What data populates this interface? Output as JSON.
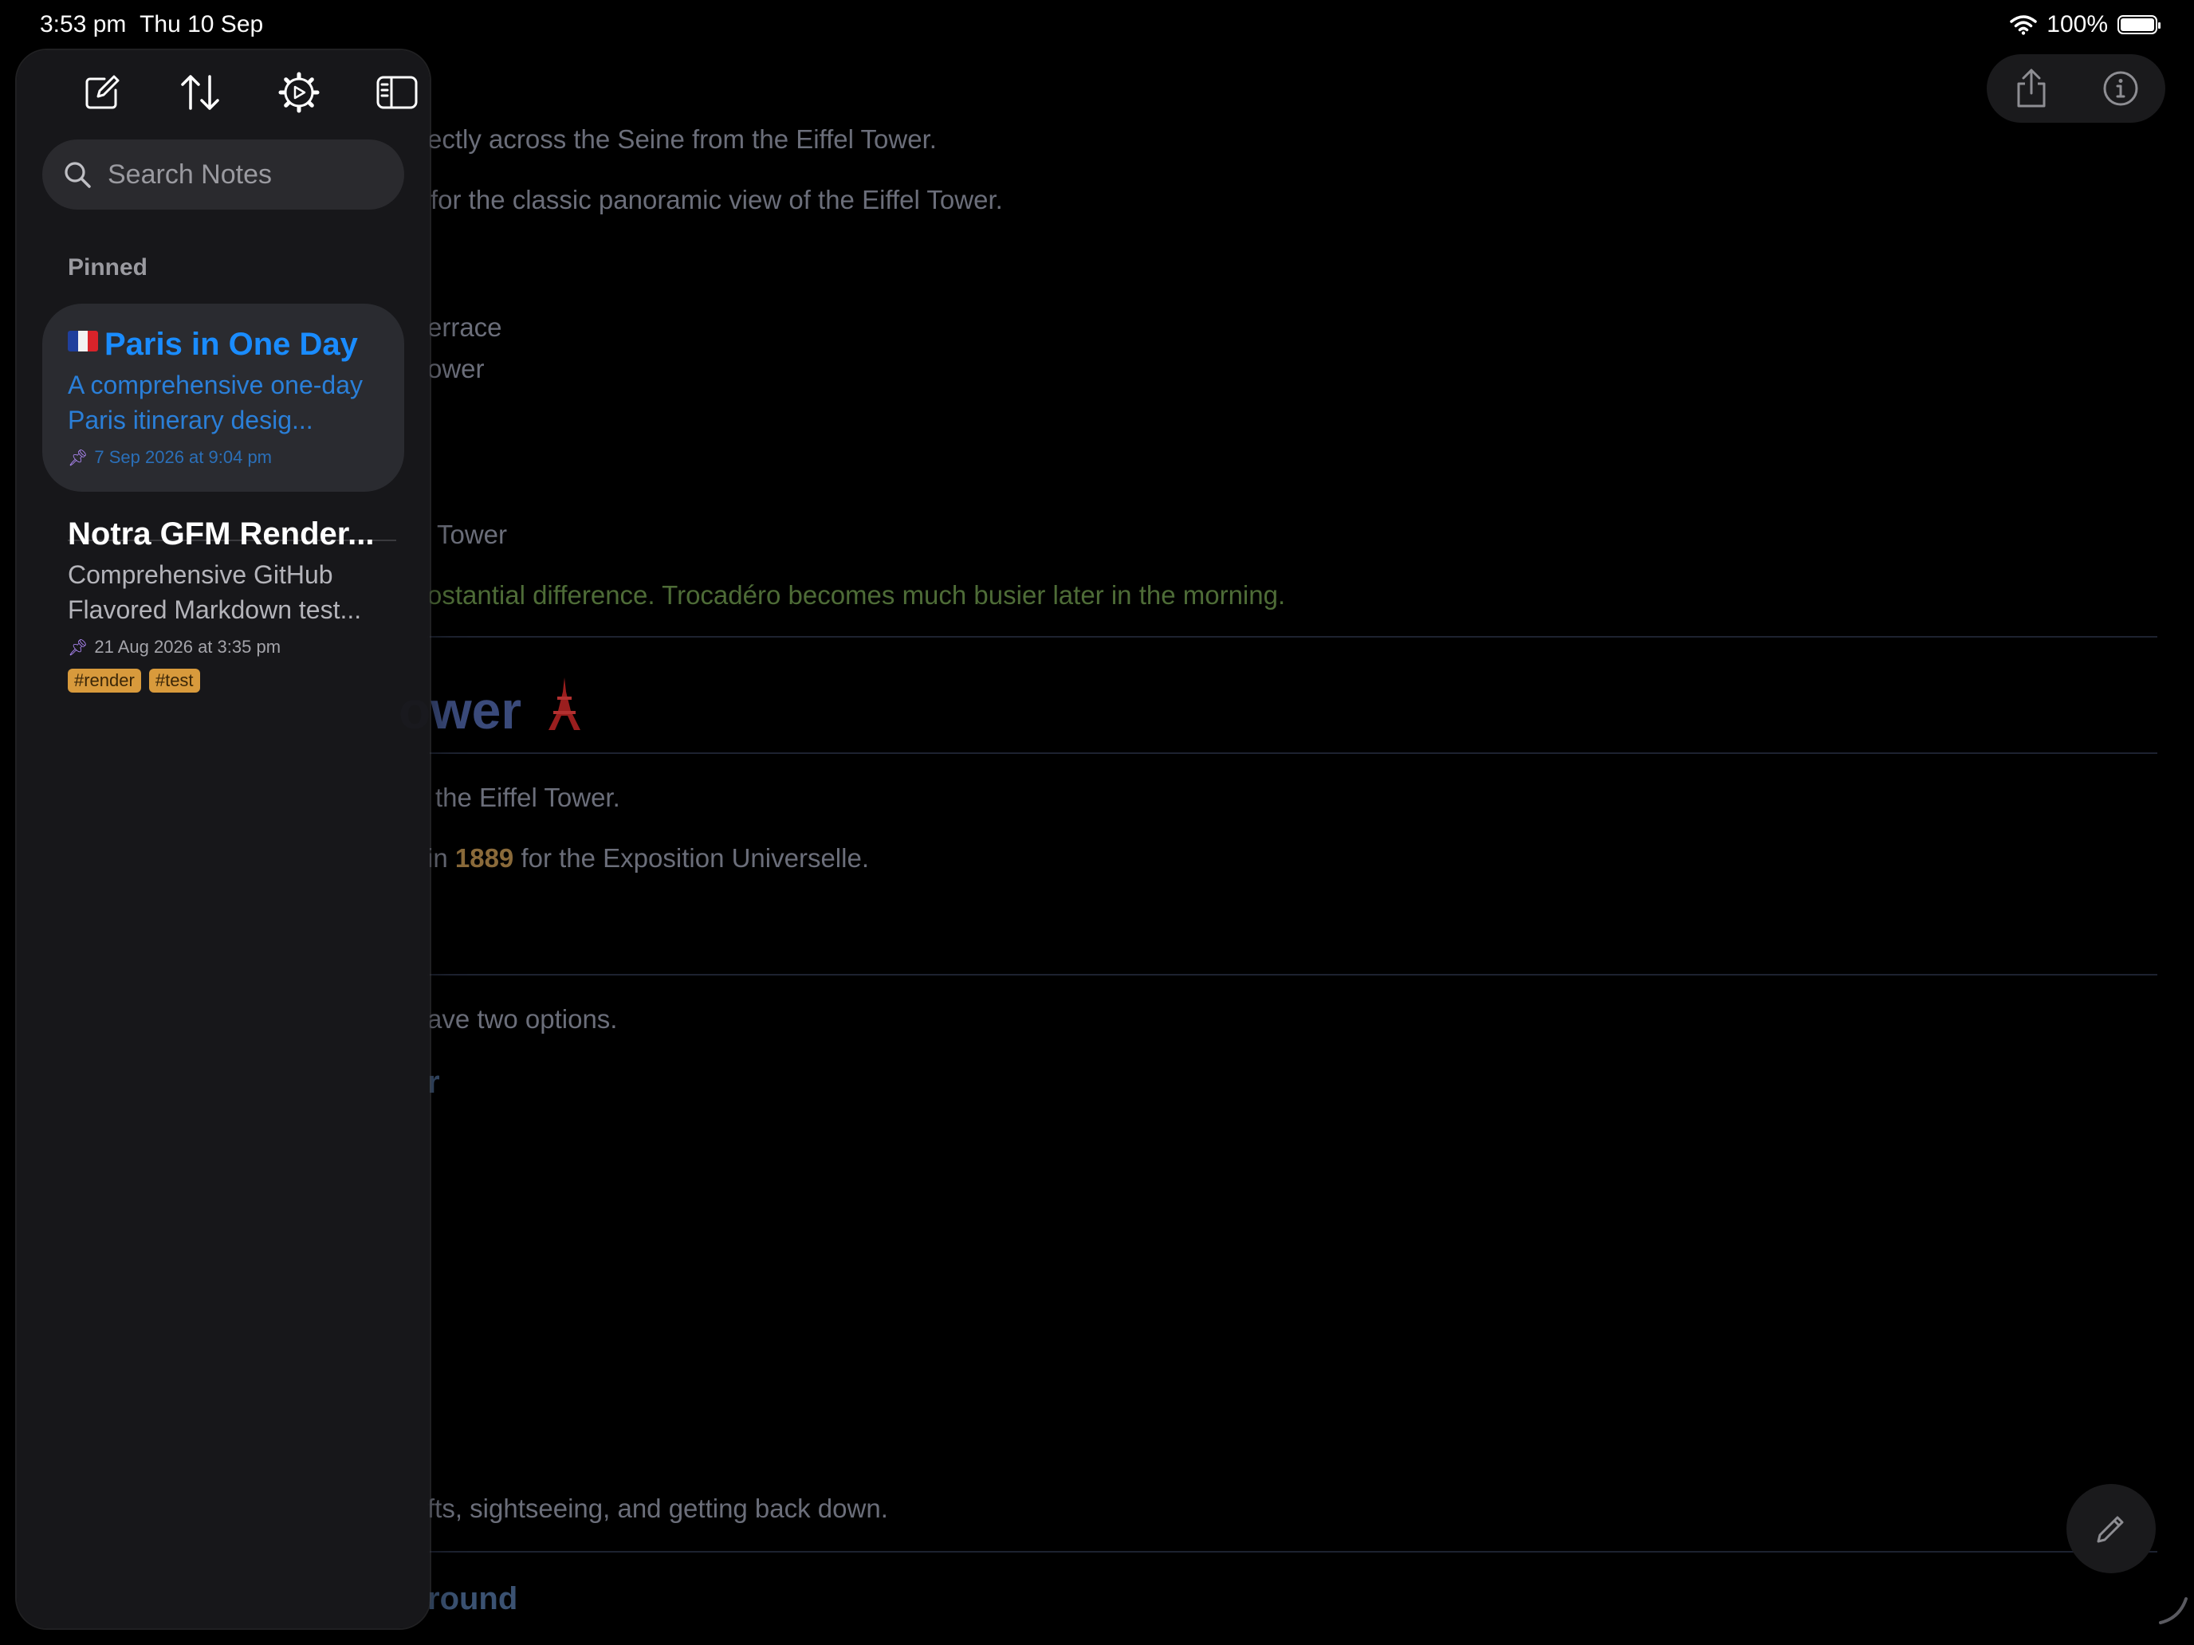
{
  "status": {
    "time": "3:53 pm",
    "date": "Thu 10 Sep",
    "battery": "100%",
    "battery_level": 1.0
  },
  "toolbar": {
    "compose_icon": "compose-icon",
    "sort_icon": "sort-icon",
    "settings_icon": "gear-icon",
    "sidebar_icon": "sidebar-icon",
    "share_icon": "share-icon",
    "info_icon": "info-icon"
  },
  "search": {
    "placeholder": "Search Notes"
  },
  "sidebar": {
    "section_label": "Pinned",
    "notes": [
      {
        "title": "Paris in One Day",
        "description": "A comprehensive one-day Paris itinerary desig...",
        "date": "7 Sep 2026 at 9:04 pm",
        "tags": []
      },
      {
        "title": "Notra GFM Render...",
        "description": "Comprehensive GitHub Flavored Markdown test...",
        "date": "21 Aug 2026 at 3:35 pm",
        "tags": [
          "#render",
          "#test"
        ]
      }
    ]
  },
  "note": {
    "l1": "ectly across the Seine from the Eiffel Tower.",
    "l2": "for the classic panoramic view of the Eiffel Tower.",
    "l3": "errace",
    "l4": "ower",
    "l5": "Tower",
    "l6": "ostantial difference. Trocadéro becomes much busier later in the morning.",
    "h1": "ower",
    "l7": "the Eiffel Tower.",
    "l8_pre": "in ",
    "l8_year": "1889",
    "l8_post": " for the Exposition Universelle.",
    "l9": "ave two options.",
    "h2a": "r",
    "l10": "fts, sightseeing, and getting back down.",
    "h2b": "round"
  },
  "colors": {
    "accent": "#1a8cff",
    "tag": "#d89a3c",
    "pin": "#b48cff"
  }
}
